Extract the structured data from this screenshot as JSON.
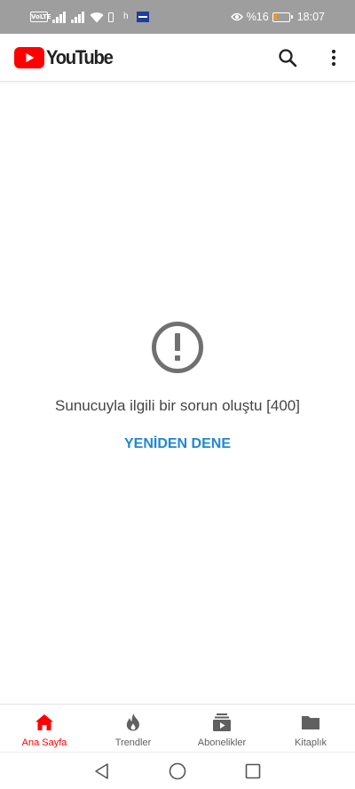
{
  "status_bar": {
    "volte_label": "VoLTE",
    "h_label": "h",
    "battery_text": "%16",
    "battery_level": 0.16,
    "time": "18:07",
    "background_color": "#9e9e9e"
  },
  "app_bar": {
    "logo_text": "YouTube",
    "brand_color": "#ff0000",
    "icons": [
      "search-icon",
      "more-vert-icon"
    ]
  },
  "error": {
    "icon": "error-icon",
    "message": "Sunucuyla ilgili bir sorun oluştu [400]",
    "retry_label": "YENİDEN DENE",
    "retry_color": "#1e88d4"
  },
  "bottom_nav": {
    "items": [
      {
        "label": "Ana Sayfa",
        "icon": "home-icon",
        "active": true
      },
      {
        "label": "Trendler",
        "icon": "trending-icon",
        "active": false
      },
      {
        "label": "Abonelikler",
        "icon": "subscriptions-icon",
        "active": false
      },
      {
        "label": "Kitaplık",
        "icon": "library-icon",
        "active": false
      }
    ],
    "active_color": "#ff0000"
  },
  "system_nav": {
    "icons": [
      "back-icon",
      "home-circle-icon",
      "recents-icon"
    ]
  }
}
